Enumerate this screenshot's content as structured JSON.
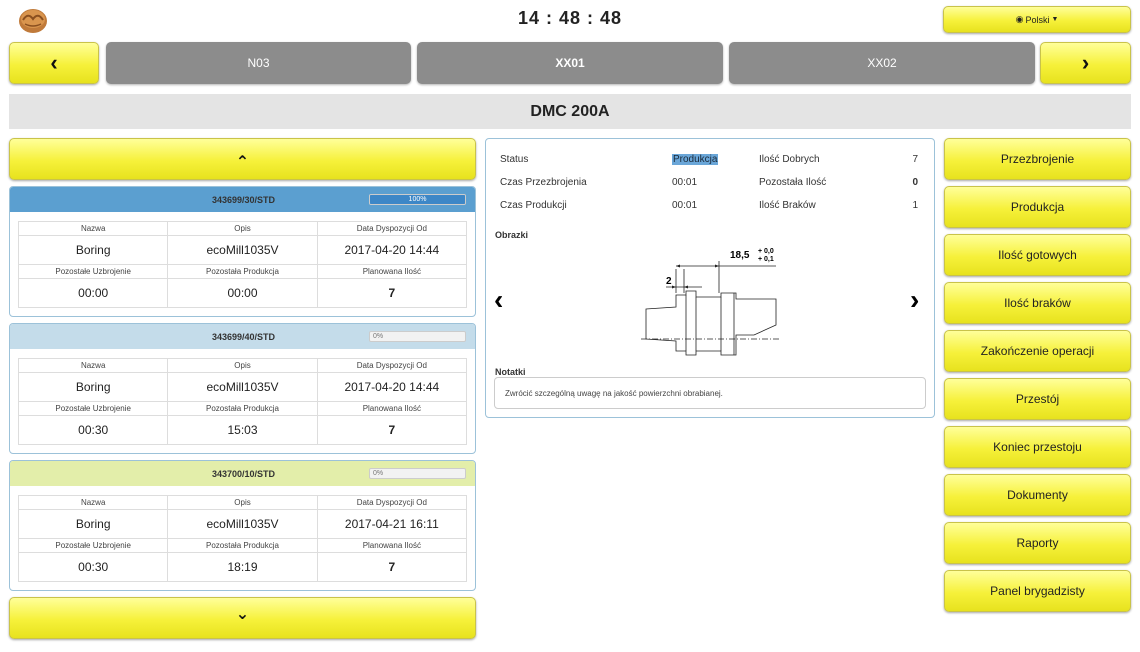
{
  "header": {
    "clock": "14 : 48 : 48",
    "language_button": "Polski",
    "logo_icon": "walnut-logo-icon",
    "globe_icon": "globe-icon",
    "caret_icon": "caret-down-icon"
  },
  "machines": {
    "prev_icon": "chevron-left-icon",
    "next_icon": "chevron-right-icon",
    "prev_glyph": "‹",
    "next_glyph": "›",
    "tabs": [
      {
        "label": "N03",
        "active": false
      },
      {
        "label": "XX01",
        "active": true
      },
      {
        "label": "XX02",
        "active": false
      }
    ]
  },
  "machine_title": "DMC 200A",
  "orders": {
    "up_glyph": "⌃",
    "down_glyph": "⌄",
    "items": [
      {
        "number": "343699/30/STD",
        "progress": 100,
        "progress_label": "100%",
        "header_color": "#5b9fd0",
        "col_headers": [
          "Nazwa",
          "Opis",
          "Data Dyspozycji Od"
        ],
        "values": [
          "Boring",
          "ecoMill1035V",
          "2017-04-20 14:44"
        ],
        "col_headers2": [
          "Pozostałe Uzbrojenie",
          "Pozostała Produkcja",
          "Planowana Ilość"
        ],
        "values2": [
          "00:00",
          "00:00",
          "7"
        ]
      },
      {
        "number": "343699/40/STD",
        "progress": 0,
        "progress_label": "0%",
        "header_color": "#c4dcea",
        "col_headers": [
          "Nazwa",
          "Opis",
          "Data Dyspozycji Od"
        ],
        "values": [
          "Boring",
          "ecoMill1035V",
          "2017-04-20 14:44"
        ],
        "col_headers2": [
          "Pozostałe Uzbrojenie",
          "Pozostała Produkcja",
          "Planowana Ilość"
        ],
        "values2": [
          "00:30",
          "15:03",
          "7"
        ]
      },
      {
        "number": "343700/10/STD",
        "progress": 0,
        "progress_label": "0%",
        "header_color": "#e3eeaa",
        "col_headers": [
          "Nazwa",
          "Opis",
          "Data Dyspozycji Od"
        ],
        "values": [
          "Boring",
          "ecoMill1035V",
          "2017-04-21 16:11"
        ],
        "col_headers2": [
          "Pozostałe Uzbrojenie",
          "Pozostała Produkcja",
          "Planowana Ilość"
        ],
        "values2": [
          "00:30",
          "18:19",
          "7"
        ]
      }
    ]
  },
  "status_panel": {
    "status_label": "Status",
    "status_value": "Produkcja",
    "setup_time_label": "Czas Przezbrojenia",
    "setup_time_value": "00:01",
    "prod_time_label": "Czas Produkcji",
    "prod_time_value": "00:01",
    "good_label": "Ilość Dobrych",
    "good_value": "7",
    "remaining_label": "Pozostała Ilość",
    "remaining_value": "0",
    "scrap_label": "Ilość Braków",
    "scrap_value": "1",
    "images_label": "Obrazki",
    "drawing_dim_main": "18,5",
    "drawing_tol_upper": "+ 0,0",
    "drawing_tol_lower": "+ 0,1",
    "drawing_dim_small": "2",
    "notes_label": "Notatki",
    "notes_text": "Zwrócić szczególną uwagę na jakość powierzchni obrabianej."
  },
  "actions": [
    "Przezbrojenie",
    "Produkcja",
    "Ilość gotowych",
    "Ilość braków",
    "Zakończenie operacji",
    "Przestój",
    "Koniec przestoju",
    "Dokumenty",
    "Raporty",
    "Panel brygadzisty"
  ],
  "colors": {
    "yellow": "#f6f13a",
    "gray_tab": "#8c8c8c",
    "accent_blue": "#3d87c7",
    "highlight": "#6aa6d8"
  }
}
